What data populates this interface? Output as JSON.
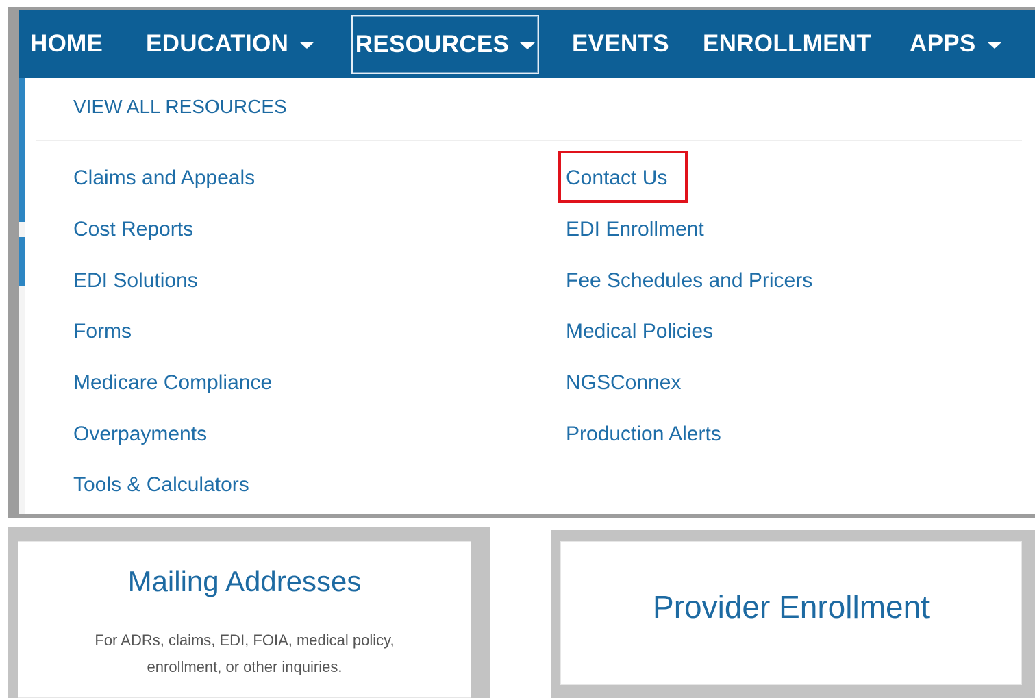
{
  "nav": {
    "home": "HOME",
    "education": "EDUCATION",
    "resources": "RESOURCES",
    "events": "EVENTS",
    "enrollment": "ENROLLMENT",
    "apps": "APPS"
  },
  "dropdown": {
    "view_all": "VIEW ALL RESOURCES",
    "left_links": [
      "Claims and Appeals",
      "Cost Reports",
      "EDI Solutions",
      "Forms",
      "Medicare Compliance",
      "Overpayments",
      "Tools & Calculators"
    ],
    "right_links": [
      "Contact Us",
      "EDI Enrollment",
      "Fee Schedules and Pricers",
      "Medical Policies",
      "NGSConnex",
      "Production Alerts"
    ],
    "highlighted": "Contact Us"
  },
  "cards": {
    "mailing": {
      "title": "Mailing Addresses",
      "description": "For ADRs, claims, EDI, FOIA, medical policy, enrollment, or other inquiries."
    },
    "provider": {
      "title": "Provider Enrollment"
    }
  },
  "colors": {
    "nav_bg": "#0d5f96",
    "link": "#1f6ea8",
    "highlight": "#e0121b"
  }
}
